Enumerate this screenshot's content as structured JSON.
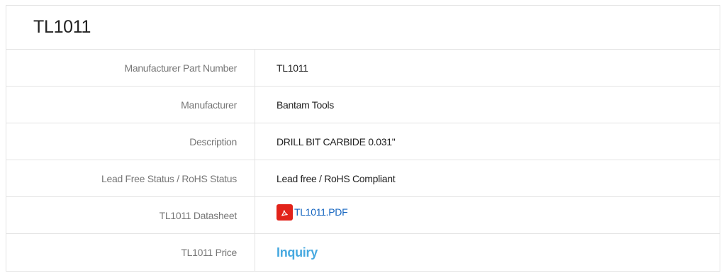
{
  "title": "TL1011",
  "rows": [
    {
      "label": "Manufacturer Part Number",
      "value": "TL1011"
    },
    {
      "label": "Manufacturer",
      "value": "Bantam Tools"
    },
    {
      "label": "Description",
      "value": "DRILL BIT CARBIDE 0.031\""
    },
    {
      "label": "Lead Free Status / RoHS Status",
      "value": "Lead free / RoHS Compliant"
    },
    {
      "label": "TL1011 Datasheet",
      "value": "TL1011.PDF",
      "icon": "pdf-icon"
    },
    {
      "label": "TL1011 Price",
      "value": "Inquiry"
    }
  ],
  "colors": {
    "border": "#e3e3e3",
    "link": "#1565c0",
    "inquiry": "#47a9e0",
    "pdf_icon": "#e2231a"
  }
}
